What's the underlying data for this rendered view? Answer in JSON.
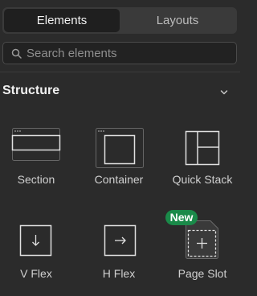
{
  "tabs": [
    {
      "label": "Elements",
      "active": true
    },
    {
      "label": "Layouts",
      "active": false
    }
  ],
  "search": {
    "placeholder": "Search elements",
    "value": ""
  },
  "section": {
    "title": "Structure",
    "collapse_icon": "chevron-down-icon"
  },
  "elements": [
    {
      "label": "Section",
      "icon": "section-icon"
    },
    {
      "label": "Container",
      "icon": "container-icon"
    },
    {
      "label": "Quick Stack",
      "icon": "quick-stack-icon"
    },
    {
      "label": "V Flex",
      "icon": "v-flex-icon"
    },
    {
      "label": "H Flex",
      "icon": "h-flex-icon"
    },
    {
      "label": "Page Slot",
      "icon": "page-slot-icon",
      "badge": "New"
    }
  ],
  "colors": {
    "badge": "#1a8a49",
    "background": "#2b2b2b"
  }
}
